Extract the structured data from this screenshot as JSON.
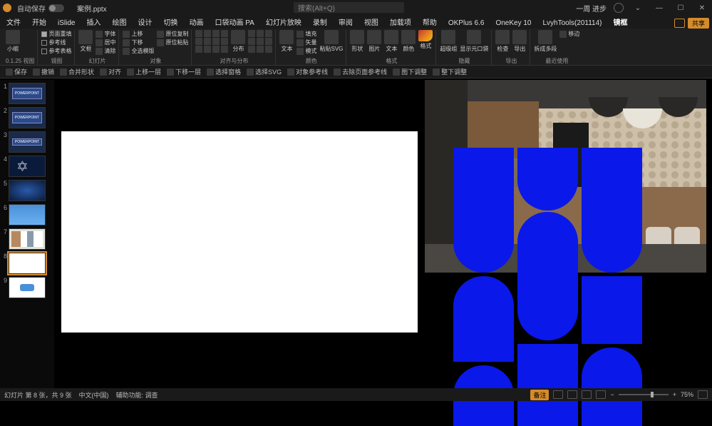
{
  "titlebar": {
    "autosave_label": "自动保存",
    "filename": "案例.pptx",
    "search_placeholder": "搜索(Alt+Q)",
    "user": "一周 进步"
  },
  "menubar": {
    "items": [
      "文件",
      "开始",
      "iSlide",
      "插入",
      "绘图",
      "设计",
      "切换",
      "动画",
      "口袋动画 PA",
      "幻灯片放映",
      "录制",
      "审阅",
      "视图",
      "加载项",
      "帮助",
      "OKPlus 6.6",
      "OneKey 10",
      "LvyhTools(201114)",
      "镜框"
    ],
    "share": "共享"
  },
  "ribbon": {
    "group_zoom": {
      "size": "小缩",
      "zoom_val": "0.1.25",
      "label": "视图"
    },
    "group_ref": {
      "checks": [
        "页面重填",
        "参考线",
        "参考表格"
      ],
      "label": "镜图"
    },
    "group_text": {
      "btn1": "文框",
      "row1": "字体",
      "row2": "居中",
      "row3": "清除",
      "label": "幻灯片"
    },
    "group_layer": {
      "row1": "上移",
      "row2": "下移",
      "row3": "全选模版",
      "col1": "原位复制",
      "col2": "原位粘贴",
      "label": "对象"
    },
    "group_align": {
      "btn": "分布",
      "label": "对齐与分布"
    },
    "group_color": {
      "btn": "粘贴SVG",
      "row1": "填充",
      "row2": "矢量",
      "row3": "模式",
      "label": "颜色"
    },
    "group_shape": {
      "btns": [
        "形状",
        "图片",
        "文本",
        "颜色"
      ],
      "brush": "格式",
      "label": "格式"
    },
    "group_cell": {
      "btn1": "超级组",
      "btn2": "显示元口袋",
      "label": "隐藏"
    },
    "group_export": {
      "btn1": "检查",
      "btn2": "导出",
      "label": "导出"
    },
    "group_split": {
      "btn1": "拆成多段",
      "row1": "移边",
      "label": "最近使用"
    }
  },
  "secondarybar": {
    "items": [
      "保存",
      "撤销",
      "",
      "合并形状",
      "对齐",
      "上移一层",
      "下移一层",
      "",
      "",
      "选择窗格",
      "选择SVG",
      "对象参考线",
      "去除页面参考线",
      "图下调整",
      "整下调整"
    ]
  },
  "thumbnails": {
    "count": 9,
    "selected": 8,
    "labels": [
      "POWERPOINT",
      "POWERPOINT",
      "POWERPOINT",
      "",
      "",
      "",
      "",
      ""
    ]
  },
  "statusbar": {
    "slide_info": "幻灯片 第 8 张，共 9 张",
    "lang": "中文(中国)",
    "access": "辅助功能: 调查",
    "notes": "备注",
    "zoom": "75%"
  }
}
